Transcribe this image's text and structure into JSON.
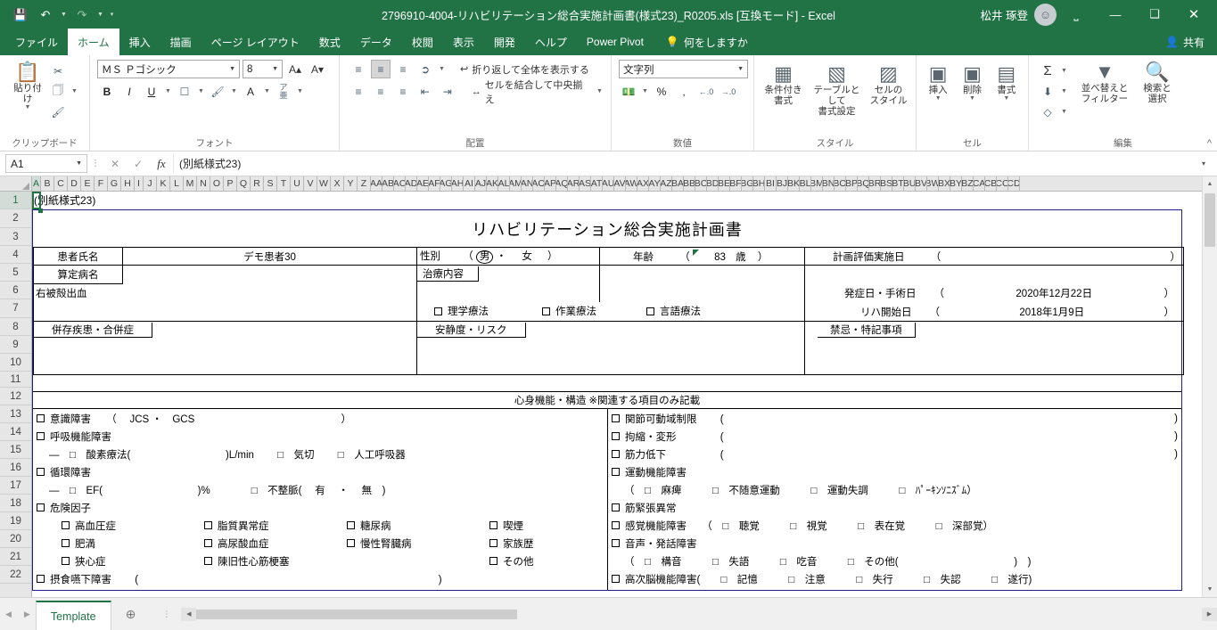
{
  "titlebar": {
    "quick_access": [
      {
        "name": "save",
        "glyph": "💾"
      },
      {
        "name": "undo",
        "glyph": "↶"
      },
      {
        "name": "redo",
        "glyph": "↷"
      },
      {
        "name": "customize",
        "glyph": "ⴿ"
      }
    ],
    "title": "2796910-4004-リハビリテーション総合実施計画書(様式23)_R0205.xls  [互換モード]  -  Excel",
    "account_name": "松井 琢登",
    "avatar_glyph": "⛉",
    "ribbon_display_glyph": "⛶",
    "minimize_glyph": "—",
    "restore_glyph": "❐",
    "close_glyph": "✕"
  },
  "ribbon": {
    "tabs": [
      {
        "label": "ファイル",
        "active": false
      },
      {
        "label": "ホーム",
        "active": true
      },
      {
        "label": "挿入",
        "active": false
      },
      {
        "label": "描画",
        "active": false
      },
      {
        "label": "ページ レイアウト",
        "active": false
      },
      {
        "label": "数式",
        "active": false
      },
      {
        "label": "データ",
        "active": false
      },
      {
        "label": "校閲",
        "active": false
      },
      {
        "label": "表示",
        "active": false
      },
      {
        "label": "開発",
        "active": false
      },
      {
        "label": "ヘルプ",
        "active": false
      },
      {
        "label": "Power Pivot",
        "active": false
      }
    ],
    "tell_me": "何をしますか",
    "tell_me_icon": "💡",
    "share_label": "共有",
    "share_icon": "👤",
    "groups": {
      "clipboard": {
        "label": "クリップボード",
        "paste_label": "貼り付け",
        "cut_label": "切り取り",
        "copy_label": "コピー",
        "format_painter_label": "書式のコピー/貼り付け"
      },
      "font": {
        "label": "フォント",
        "font_name": "ＭＳ Ｐゴシック",
        "font_size": "8",
        "grow_label": "フォント サイズの拡大",
        "shrink_label": "フォント サイズの縮小",
        "bold": "B",
        "italic": "I",
        "underline": "U",
        "border_label": "罫線",
        "fill_label": "塗りつぶしの色",
        "fontcolor_label": "フォントの色",
        "phonetic_label": "ふりがなの表示/非表示"
      },
      "alignment": {
        "label": "配置",
        "wrap_text": "折り返して全体を表示する",
        "merge_center": "セルを結合して中央揃え",
        "orientation_label": "方向",
        "indent_dec_label": "インデントを減らす",
        "indent_inc_label": "インデントを増やす"
      },
      "number": {
        "label": "数値",
        "format": "文字列",
        "accounting_label": "通貨表示形式",
        "percent_label": "%",
        "comma_label": ",",
        "dec_inc_label": "小数点以下の表示桁数を増やす",
        "dec_dec_label": "小数点以下の表示桁数を減らす"
      },
      "styles": {
        "label": "スタイル",
        "conditional": "条件付き\n書式",
        "conditional_l1": "条件付き",
        "conditional_l2": "書式",
        "as_table_l1": "テーブルとして",
        "as_table_l2": "書式設定",
        "cell_styles_l1": "セルの",
        "cell_styles_l2": "スタイル"
      },
      "cells": {
        "label": "セル",
        "insert": "挿入",
        "delete": "削除",
        "format": "書式"
      },
      "editing": {
        "label": "編集",
        "autosum_label": "オートSUM",
        "fill_label": "フィル",
        "clear_label": "クリア",
        "sort_filter_l1": "並べ替えと",
        "sort_filter_l2": "フィルター",
        "find_select_l1": "検索と",
        "find_select_l2": "選択"
      }
    },
    "collapse_glyph": "˄"
  },
  "formula_bar": {
    "name_box": "A1",
    "cancel_glyph": "✕",
    "enter_glyph": "✓",
    "fx_label": "fx",
    "content": "(別紙様式23)",
    "expand_glyph": "˅"
  },
  "grid": {
    "columns": [
      "A",
      "B",
      "C",
      "D",
      "E",
      "F",
      "G",
      "H",
      "I",
      "J",
      "K",
      "L",
      "M",
      "N",
      "O",
      "P",
      "Q",
      "R",
      "S",
      "T",
      "U",
      "V",
      "W",
      "X",
      "Y",
      "Z",
      "AA",
      "AB",
      "AC",
      "AD",
      "AE",
      "AF",
      "AG",
      "AH",
      "AI",
      "AJ",
      "AK",
      "AL",
      "AM",
      "AN",
      "AO",
      "AP",
      "AQ",
      "AR",
      "AS",
      "AT",
      "AU",
      "AV",
      "AW",
      "AX",
      "AY",
      "AZ",
      "BA",
      "BB",
      "BC",
      "BD",
      "BE",
      "BF",
      "BG",
      "BH",
      "BI",
      "BJ",
      "BK",
      "BL",
      "BM",
      "BN",
      "BO",
      "BP",
      "BQ",
      "BR",
      "BS",
      "BT",
      "BU",
      "BV",
      "BW",
      "BX",
      "BY",
      "BZ",
      "CA",
      "CB",
      "CC",
      "CD"
    ],
    "rows": [
      "1",
      "2",
      "3",
      "4",
      "5",
      "6",
      "7",
      "8",
      "9",
      "10",
      "11",
      "12",
      "13",
      "14",
      "15",
      "16",
      "17",
      "18",
      "19",
      "20",
      "21",
      "22"
    ],
    "selected_cell": "A1"
  },
  "sheet": {
    "a1_text": "(別紙様式23)",
    "doc_title": "リハビリテーション総合実施計画書",
    "patient_name_label": "患者氏名",
    "patient_name_value": "デモ患者30",
    "sex_label": "性別",
    "sex_open": "（",
    "sex_male": "男",
    "sex_sep": "・",
    "sex_female": "女",
    "sex_close": "）",
    "age_label": "年齢",
    "age_open": "（",
    "age_value": "83",
    "age_unit": "歳",
    "age_close": "）",
    "eval_date_label": "計画評価実施日",
    "eval_date_open": "（",
    "eval_date_value": "",
    "eval_date_close": "）",
    "dx_label": "算定病名",
    "dx_value": "右被殻出血",
    "treatment_label": "治療内容",
    "treatment_items": [
      "理学療法",
      "作業療法",
      "言語療法"
    ],
    "onset_label": "発症日・手術日",
    "onset_open": "（",
    "onset_value": "2020年12月22日",
    "onset_close": "）",
    "rehab_start_label": "リハ開始日",
    "rehab_start_open": "（",
    "rehab_start_value": "2018年1月9日",
    "rehab_start_close": "）",
    "comorbid_label": "併存疾患・合併症",
    "rest_risk_label": "安静度・リスク",
    "contra_label": "禁忌・特記事項",
    "section_title": "心身機能・構造 ※関連する項目のみ記載",
    "left_column": [
      {
        "indent": 0,
        "checkbox": true,
        "text": "意識障害　　（　 JCS ・　GCS 　　　　　　　　　　　　　　）"
      },
      {
        "indent": 0,
        "checkbox": true,
        "text": "呼吸機能障害"
      },
      {
        "indent": 1,
        "checkbox": false,
        "text": "―　□　酸素療法(　　　　　　　　　 )L/min 　　□　気切　　 □　人工呼吸器"
      },
      {
        "indent": 0,
        "checkbox": true,
        "text": "循環障害"
      },
      {
        "indent": 1,
        "checkbox": false,
        "text": "―　□　EF(　　　　　　　　　 )%　　　　□　不整脈( 　有　 ・　 無　)"
      },
      {
        "indent": 0,
        "checkbox": true,
        "text": "危険因子"
      },
      {
        "indent": 2,
        "checkbox": false,
        "text": "row_risk_1"
      },
      {
        "indent": 2,
        "checkbox": false,
        "text": "row_risk_2"
      },
      {
        "indent": 2,
        "checkbox": false,
        "text": "row_risk_3"
      },
      {
        "indent": 0,
        "checkbox": true,
        "text": "摂食嚥下障害　　 (　　　　　　　　　　　　　　　　　　　　　　　　　　　　　 )"
      }
    ],
    "risk_rows": [
      [
        "高血圧症",
        "脂質異常症",
        "糖尿病",
        "喫煙"
      ],
      [
        "肥満",
        "高尿酸血症",
        "慢性腎臓病",
        "家族歴"
      ],
      [
        "狭心症",
        "陳旧性心筋梗塞",
        "",
        "その他"
      ]
    ],
    "right_column": [
      {
        "checkbox": true,
        "text": "関節可動域制限　　 (",
        "tail": ")"
      },
      {
        "checkbox": true,
        "text": "拘縮・変形　　　　 (",
        "tail": ")"
      },
      {
        "checkbox": true,
        "text": "筋力低下　　　　　 (",
        "tail": ")"
      },
      {
        "checkbox": true,
        "text": "運動機能障害",
        "tail": ""
      },
      {
        "checkbox": false,
        "text": "（　□　麻痺　　　□　不随意運動　　　□　運動失調　　　□　ﾊﾟｰｷﾝｿﾆｽﾞﾑ）",
        "tail": ""
      },
      {
        "checkbox": true,
        "text": "筋緊張異常",
        "tail": ""
      },
      {
        "checkbox": true,
        "text": "感覚機能障害　　（　□　聴覚　　　□　視覚　　　□　表在覚　　　□　深部覚）",
        "tail": ""
      },
      {
        "checkbox": true,
        "text": "音声・発話障害",
        "tail": ""
      },
      {
        "checkbox": false,
        "text": "（　□　構音　　　□　失語　　　□　吃音　　　□　その他(　　　　　　　　　　　 )　)",
        "tail": ""
      },
      {
        "checkbox": true,
        "text": "高次脳機能障害(　　□　記憶　　　□　注意　　　□　失行　　　□　失認　　　□　遂行)",
        "tail": ""
      }
    ]
  },
  "bottom": {
    "prev_glyph": "◀",
    "next_glyph": "▶",
    "sheet_tab": "Template",
    "add_sheet_glyph": "⊕",
    "left_arrow": "◀",
    "right_arrow": "▶"
  },
  "colors": {
    "accent": "#217346",
    "grid_border": "#1f1f8f",
    "header_bg": "#e6e6e6"
  }
}
